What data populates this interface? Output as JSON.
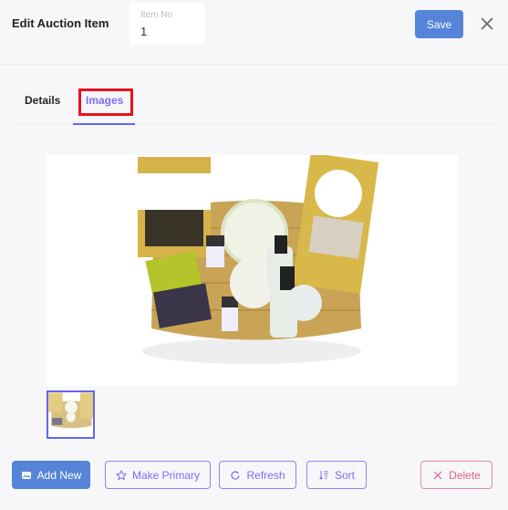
{
  "header": {
    "title": "Edit Auction Item",
    "item_no_label": "Item No",
    "item_no_value": "1",
    "save_label": "Save",
    "close_icon": "close-icon"
  },
  "tabs": [
    {
      "label": "Details",
      "active": false
    },
    {
      "label": "Images",
      "active": true
    }
  ],
  "colors": {
    "accent": "#6366f1",
    "primary": "#5584d8",
    "danger": "#e0607e",
    "highlight": "#e8121d"
  },
  "images": {
    "count": 1,
    "selected": 0
  },
  "actions": {
    "add_new": "Add New",
    "make_primary": "Make Primary",
    "refresh": "Refresh",
    "sort": "Sort",
    "delete": "Delete"
  }
}
